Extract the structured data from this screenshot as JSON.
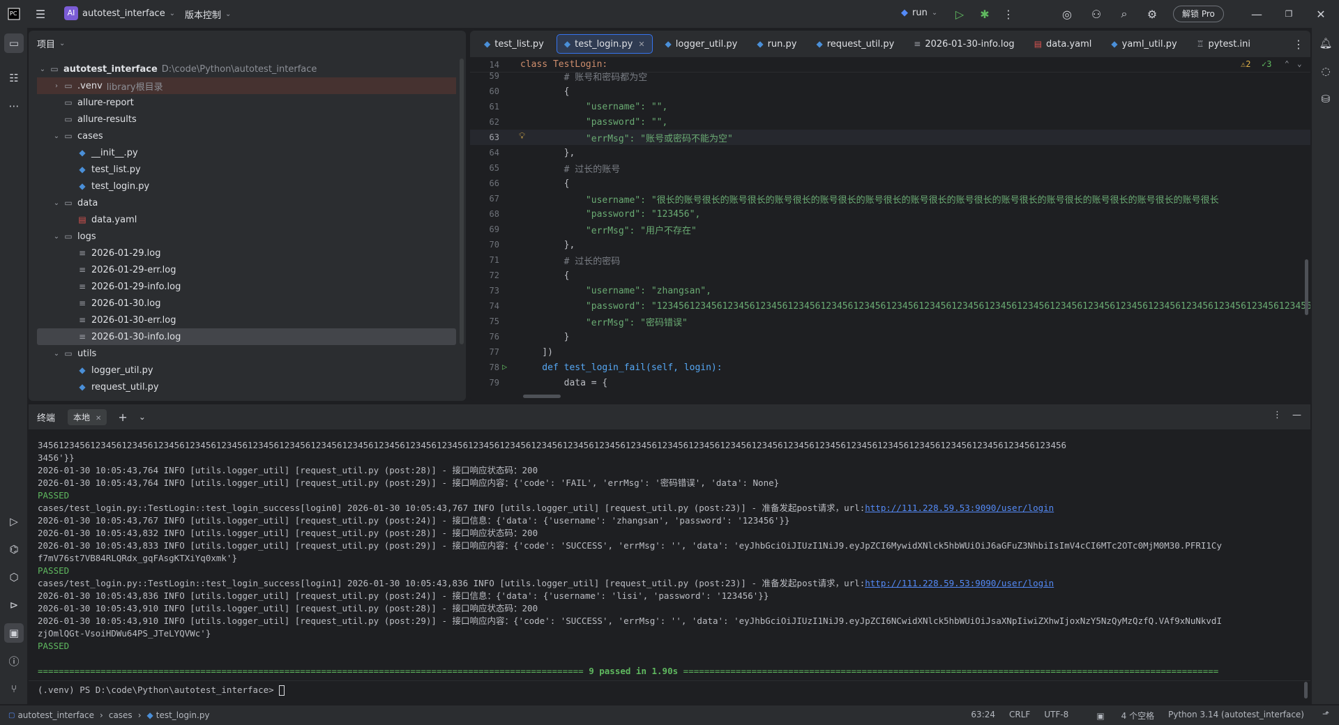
{
  "titlebar": {
    "project_badge": "AI",
    "project_name": "autotest_interface",
    "vcs": "版本控制",
    "run_config": "run",
    "unlock_pro": "解锁 Pro"
  },
  "project": {
    "header": "项目",
    "tree": [
      {
        "label": "autotest_interface",
        "hint": "D:\\code\\Python\\autotest_interface"
      },
      {
        "label": ".venv",
        "hint": "library根目录"
      },
      {
        "label": "allure-report"
      },
      {
        "label": "allure-results"
      },
      {
        "label": "cases"
      },
      {
        "label": "__init__.py"
      },
      {
        "label": "test_list.py"
      },
      {
        "label": "test_login.py"
      },
      {
        "label": "data"
      },
      {
        "label": "data.yaml"
      },
      {
        "label": "logs"
      },
      {
        "label": "2026-01-29.log"
      },
      {
        "label": "2026-01-29-err.log"
      },
      {
        "label": "2026-01-29-info.log"
      },
      {
        "label": "2026-01-30.log"
      },
      {
        "label": "2026-01-30-err.log"
      },
      {
        "label": "2026-01-30-info.log"
      },
      {
        "label": "utils"
      },
      {
        "label": "logger_util.py"
      },
      {
        "label": "request_util.py"
      }
    ]
  },
  "editor": {
    "tabs": [
      "test_list.py",
      "test_login.py",
      "logger_util.py",
      "run.py",
      "request_util.py",
      "2026-01-30-info.log",
      "data.yaml",
      "yaml_util.py",
      "pytest.ini"
    ],
    "sticky_line_no": "14",
    "sticky_text": "class TestLogin:",
    "warnings": "2",
    "checks": "3",
    "lines": [
      {
        "no": "59",
        "text": "        # 账号和密码都为空"
      },
      {
        "no": "60",
        "text": "        {"
      },
      {
        "no": "61",
        "text": "            \"username\": \"\","
      },
      {
        "no": "62",
        "text": "            \"password\": \"\","
      },
      {
        "no": "63",
        "text": "            \"errMsg\": \"账号或密码不能为空\""
      },
      {
        "no": "64",
        "text": "        },"
      },
      {
        "no": "65",
        "text": "        # 过长的账号"
      },
      {
        "no": "66",
        "text": "        {"
      },
      {
        "no": "67",
        "text": "            \"username\": \"很长的账号很长的账号很长的账号很长的账号很长的账号很长的账号很长的账号很长的账号很长的账号很长的账号很长的账号很长的账号很长"
      },
      {
        "no": "68",
        "text": "            \"password\": \"123456\","
      },
      {
        "no": "69",
        "text": "            \"errMsg\": \"用户不存在\""
      },
      {
        "no": "70",
        "text": "        },"
      },
      {
        "no": "71",
        "text": "        # 过长的密码"
      },
      {
        "no": "72",
        "text": "        {"
      },
      {
        "no": "73",
        "text": "            \"username\": \"zhangsan\","
      },
      {
        "no": "74",
        "text": "            \"password\": \"12345612345612345612345612345612345612345612345612345612345612345612345612345612345612345612345612345612345612345612345612"
      },
      {
        "no": "75",
        "text": "            \"errMsg\": \"密码错误\""
      },
      {
        "no": "76",
        "text": "        }"
      },
      {
        "no": "77",
        "text": "    ])"
      },
      {
        "no": "78",
        "text": "    def test_login_fail(self, login):"
      },
      {
        "no": "79",
        "text": "        data = {"
      }
    ]
  },
  "terminal": {
    "title": "终端",
    "tab": "本地",
    "lines": [
      "3456123456123456123456123456123456123456123456123456123456123456123456123456123456123456123456123456123456123456123456123456123456123456123456123456123456123456123456123456123456123456123456123456",
      "3456'}}",
      "2026-01-30 10:05:43,764 INFO [utils.logger_util] [request_util.py (post:28)] - 接口响应状态码：200",
      "2026-01-30 10:05:43,764 INFO [utils.logger_util] [request_util.py (post:29)] - 接口响应内容：{'code': 'FAIL', 'errMsg': '密码错误', 'data': None}",
      "PASSED",
      "cases/test_login.py::TestLogin::test_login_success[login0] 2026-01-30 10:05:43,767 INFO [utils.logger_util] [request_util.py (post:23)] - 准备发起post请求，url:",
      "2026-01-30 10:05:43,767 INFO [utils.logger_util] [request_util.py (post:24)] - 接口信息：{'data': {'username': 'zhangsan', 'password': '123456'}}",
      "2026-01-30 10:05:43,832 INFO [utils.logger_util] [request_util.py (post:28)] - 接口响应状态码：200",
      "2026-01-30 10:05:43,833 INFO [utils.logger_util] [request_util.py (post:29)] - 接口响应内容：{'code': 'SUCCESS', 'errMsg': '', 'data': 'eyJhbGciOiJIUzI1NiJ9.eyJpZCI6MywidXNlck5hbWUiOiJ6aGFuZ3NhbiIsImV4cCI6MTc2OTc0MjM0M30.PFRI1Cy",
      "f7mV76st7VB84RLQRdx_gqFAsgKTXiYq0xmk'}",
      "PASSED",
      "cases/test_login.py::TestLogin::test_login_success[login1] 2026-01-30 10:05:43,836 INFO [utils.logger_util] [request_util.py (post:23)] - 准备发起post请求，url:",
      "2026-01-30 10:05:43,836 INFO [utils.logger_util] [request_util.py (post:24)] - 接口信息：{'data': {'username': 'lisi', 'password': '123456'}}",
      "2026-01-30 10:05:43,910 INFO [utils.logger_util] [request_util.py (post:28)] - 接口响应状态码：200",
      "2026-01-30 10:05:43,910 INFO [utils.logger_util] [request_util.py (post:29)] - 接口响应内容：{'code': 'SUCCESS', 'errMsg': '', 'data': 'eyJhbGciOiJIUzI1NiJ9.eyJpZCI6NCwidXNlck5hbWUiOiJsaXNpIiwiZXhwIjoxNzY5NzQyMzQzfQ.VAf9xNuNkvdI",
      "zjOmlQGt-VsoiHDWu64PS_JTeLYQVWc'}",
      "PASSED"
    ],
    "url": "http://111.228.59.53:9090/user/login",
    "summary_left": "======================================================================================================== ",
    "summary": "9 passed in 1.90s",
    "summary_right": " ======================================================================================================",
    "prompt": "(.venv) PS D:\\code\\Python\\autotest_interface> "
  },
  "statusbar": {
    "crumbs": [
      "autotest_interface",
      "cases",
      "test_login.py"
    ],
    "position": "63:24",
    "line_sep": "CRLF",
    "encoding": "UTF-8",
    "indent": "4 个空格",
    "interpreter": "Python 3.14 (autotest_interface)"
  }
}
